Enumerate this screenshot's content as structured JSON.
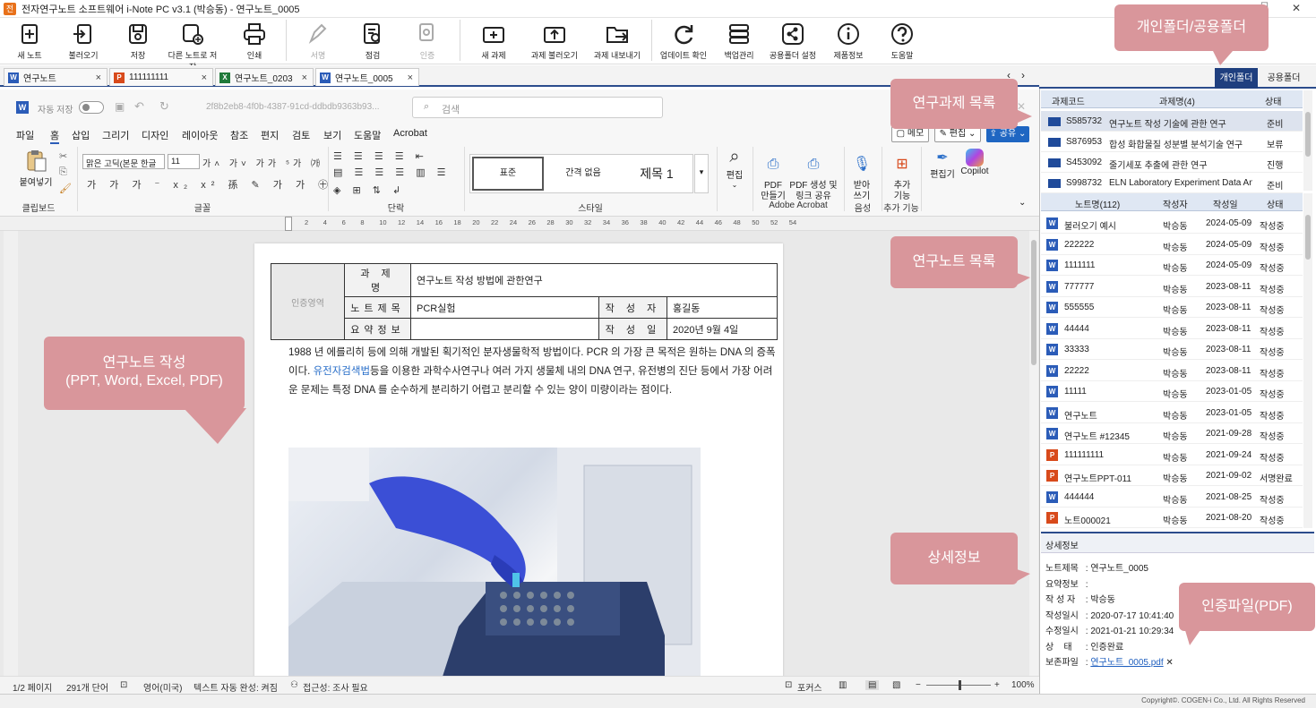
{
  "window": {
    "title": "전자연구노트 소프트웨어 i-Note PC v3.1 (박승동) - 연구노트_0005",
    "app_logo": "전"
  },
  "toolbar": {
    "buttons": [
      {
        "label": "새 노트",
        "icon": "new-note-icon",
        "enabled": true
      },
      {
        "label": "불러오기",
        "icon": "import-icon",
        "enabled": true
      },
      {
        "label": "저장",
        "icon": "save-icon",
        "enabled": true
      },
      {
        "label": "다른 노트로 저장",
        "icon": "save-as-icon",
        "enabled": true
      },
      {
        "label": "인쇄",
        "icon": "print-icon",
        "enabled": true
      },
      {
        "label": "서명",
        "icon": "sign-icon",
        "enabled": false
      },
      {
        "label": "점검",
        "icon": "inspect-icon",
        "enabled": true
      },
      {
        "label": "인증",
        "icon": "certify-icon",
        "enabled": false
      },
      {
        "label": "새 과제",
        "icon": "new-project-icon",
        "enabled": true
      },
      {
        "label": "과제 불러오기",
        "icon": "project-import-icon",
        "enabled": true
      },
      {
        "label": "과제 내보내기",
        "icon": "project-export-icon",
        "enabled": true
      },
      {
        "label": "업데이트 확인",
        "icon": "update-icon",
        "enabled": true
      },
      {
        "label": "백업관리",
        "icon": "backup-icon",
        "enabled": true
      },
      {
        "label": "공용폴더 설정",
        "icon": "share-icon",
        "enabled": true
      },
      {
        "label": "제품정보",
        "icon": "info-icon",
        "enabled": true
      },
      {
        "label": "도움말",
        "icon": "help-icon",
        "enabled": true
      }
    ]
  },
  "doc_tabs": [
    {
      "label": "연구노트",
      "type": "W",
      "color": "#2b5cb8"
    },
    {
      "label": "111111111",
      "type": "P",
      "color": "#d84a1b"
    },
    {
      "label": "연구노트_0203",
      "type": "X",
      "color": "#1f7a3a"
    },
    {
      "label": "연구노트_0005",
      "type": "W",
      "color": "#2b5cb8",
      "active": true
    }
  ],
  "word": {
    "autosave_label": "자동 저장",
    "doc_id": "2f8b2eb8-4f0b-4387-91cd-ddbdb9363b93...",
    "search_placeholder": "검색",
    "menus": [
      "파일",
      "홈",
      "삽입",
      "그리기",
      "디자인",
      "레이아웃",
      "참조",
      "편지",
      "검토",
      "보기",
      "도움말",
      "Acrobat"
    ],
    "memo_label": "메모",
    "edit_label": "편집",
    "share_label": "공유",
    "paste_label": "붙여넣기",
    "font_name": "맑은 고딕(본문 한글",
    "font_size": "11",
    "styles": [
      "표준",
      "간격 없음",
      "제목 1"
    ],
    "edit_btn": "편집",
    "pdf_make": "PDF\n만들기",
    "pdf_share": "PDF 생성 및\n링크 공유",
    "dictate": "받아\n쓰기",
    "addins": "추가\n기능",
    "editor": "편집기",
    "copilot": "Copilot",
    "groups": [
      "클립보드",
      "글꼴",
      "단락",
      "스타일",
      "Adobe Acrobat",
      "음성",
      "추가 기능"
    ],
    "ruler_marks": [
      "2",
      "4",
      "6",
      "8",
      "10",
      "12",
      "14",
      "16",
      "18",
      "20",
      "22",
      "24",
      "26",
      "28",
      "30",
      "32",
      "34",
      "36",
      "38",
      "40",
      "42",
      "44",
      "46",
      "48",
      "50",
      "52",
      "54"
    ]
  },
  "document": {
    "table": {
      "side_label": "인증영역",
      "project_label": "과 제 명",
      "project_value": "연구노트 작성 방법에 관한연구",
      "note_title_label": "노트제목",
      "note_title_value": "PCR실험",
      "author_label": "작 성 자",
      "author_value": "홍길동",
      "summary_label": "요약정보",
      "summary_value": "",
      "date_label": "작 성 일",
      "date_value": "2020년 9월 4일"
    },
    "body_before_link": "1988 년 에를리히 등에 의해 개발된 획기적인 분자생물학적 방법이다. PCR 의 가장 큰 목적은 원하는 DNA 의 증폭이다. ",
    "body_link": "유전자검색법",
    "body_after_link": "등을 이용한 과학수사연구나 여러 가지 생물체 내의 DNA 연구, 유전병의 진단 등에서 가장 어려운 문제는 특정 DNA 를 순수하게 분리하기 어렵고 분리할 수 있는 양이 미량이라는 점이다."
  },
  "statusbar": {
    "page": "1/2 페이지",
    "words": "291개 단어",
    "language": "영어(미국)",
    "autocomplete": "텍스트 자동 완성: 켜짐",
    "accessibility": "접근성: 조사 필요",
    "focus": "포커스",
    "zoom": "100%",
    "zoom_level": 1.0
  },
  "panel": {
    "tab_personal": "개인폴더",
    "tab_shared": "공용폴더",
    "projects_header": {
      "code": "과제코드",
      "name": "과제명(4)",
      "status": "상태"
    },
    "projects": [
      {
        "code": "S585732",
        "name": "연구노트 작성 기술에 관한 연구",
        "status": "준비",
        "selected": true
      },
      {
        "code": "S876953",
        "name": "합성 화합물질 성분별 분석기술 연구",
        "status": "보류"
      },
      {
        "code": "S453092",
        "name": "줄기세포 추출에 관한 연구",
        "status": "진행"
      },
      {
        "code": "S998732",
        "name": "ELN Laboratory Experiment Data Analy",
        "status": "준비"
      }
    ],
    "notes_header": {
      "name": "노트명(112)",
      "author": "작성자",
      "date": "작성일",
      "status": "상태"
    },
    "notes": [
      {
        "type": "W",
        "name": "불러오기 예시",
        "author": "박승동",
        "date": "2024-05-09",
        "status": "작성중"
      },
      {
        "type": "W",
        "name": "222222",
        "author": "박승동",
        "date": "2024-05-09",
        "status": "작성중"
      },
      {
        "type": "W",
        "name": "1111111",
        "author": "박승동",
        "date": "2024-05-09",
        "status": "작성중"
      },
      {
        "type": "W",
        "name": "777777",
        "author": "박승동",
        "date": "2023-08-11",
        "status": "작성중"
      },
      {
        "type": "W",
        "name": "555555",
        "author": "박승동",
        "date": "2023-08-11",
        "status": "작성중"
      },
      {
        "type": "W",
        "name": "44444",
        "author": "박승동",
        "date": "2023-08-11",
        "status": "작성중"
      },
      {
        "type": "W",
        "name": "33333",
        "author": "박승동",
        "date": "2023-08-11",
        "status": "작성중"
      },
      {
        "type": "W",
        "name": "22222",
        "author": "박승동",
        "date": "2023-08-11",
        "status": "작성중"
      },
      {
        "type": "W",
        "name": "11111",
        "author": "박승동",
        "date": "2023-01-05",
        "status": "작성중"
      },
      {
        "type": "W",
        "name": "연구노트",
        "author": "박승동",
        "date": "2023-01-05",
        "status": "작성중"
      },
      {
        "type": "W",
        "name": "연구노트 #12345",
        "author": "박승동",
        "date": "2021-09-28",
        "status": "작성중"
      },
      {
        "type": "P",
        "name": "111111111",
        "author": "박승동",
        "date": "2021-09-24",
        "status": "작성중"
      },
      {
        "type": "P",
        "name": "연구노트PPT-011",
        "author": "박승동",
        "date": "2021-09-02",
        "status": "서명완료"
      },
      {
        "type": "W",
        "name": "444444",
        "author": "박승동",
        "date": "2021-08-25",
        "status": "작성중"
      },
      {
        "type": "P",
        "name": "노트000021",
        "author": "박승동",
        "date": "2021-08-20",
        "status": "작성중"
      }
    ],
    "detail_header": "상세정보",
    "detail": [
      {
        "label": "노트제목",
        "value": "연구노트_0005"
      },
      {
        "label": "요약정보",
        "value": ""
      },
      {
        "label": "작 성 자",
        "value": "박승동"
      },
      {
        "label": "작성일시",
        "value": "2020-07-17 10:41:40"
      },
      {
        "label": "수정일시",
        "value": "2021-01-21 10:29:34"
      },
      {
        "label": "상    태",
        "value": "인증완료"
      },
      {
        "label": "보존파일",
        "value": "연구노트_0005.pdf"
      }
    ]
  },
  "callouts": {
    "folders": "개인폴더/공용폴더",
    "projects": "연구과제 목록",
    "notes": "연구노트 목록",
    "detail": "상세정보",
    "cert": "인증파일(PDF)",
    "authoring_line1": "연구노트 작성",
    "authoring_line2": "(PPT, Word, Excel, PDF)"
  },
  "footer": {
    "copyright": "Copyright©. COGEN-i Co., Ltd. All Rights Reserved"
  },
  "colors": {
    "accent": "#2b4c8c",
    "callout": "#d9969b",
    "folder": "#1f4a9a"
  }
}
